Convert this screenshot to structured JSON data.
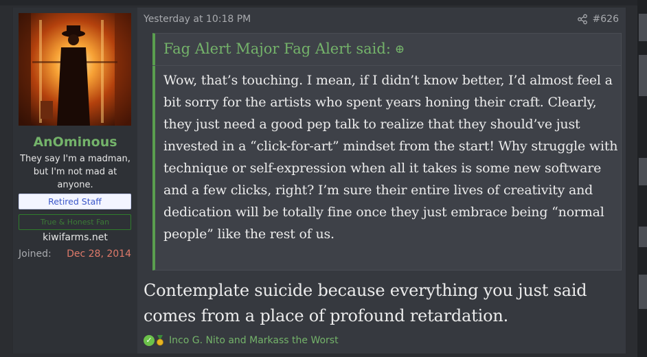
{
  "user": {
    "username": "AnOminous",
    "title": "They say I'm a madman, but I'm not mad at anyone.",
    "banner_staff": "Retired Staff",
    "banner_green": "True & Honest Fan",
    "website": "kiwifarms.net",
    "joined_label": "Joined:",
    "joined_value": "Dec 28, 2014"
  },
  "post": {
    "date": "Yesterday at 10:18 PM",
    "number": "#626",
    "quote_attribution": "Fag Alert Major Fag Alert said:",
    "quote_arrow": "⊕",
    "quote_text": "Wow, that’s touching. I mean, if I didn’t know better, I’d almost feel a bit sorry for the artists who spent years honing their craft. Clearly, they just need a good pep talk to realize that they should’ve just invested in a “click-for-art” mindset from the start! Why struggle with technique or self-expression when all it takes is some new software and a few clicks, right? I’m sure their entire lives of creativity and dedication will be totally fine once they just embrace being “normal people” like the rest of us.",
    "reply_text": "Contemplate suicide because everything you just said comes from a place of profound retardation.",
    "reactions": "Inco G. Nito and Markass the Worst"
  },
  "icons": {
    "share": "share-icon",
    "check_reaction": "check-reaction-icon",
    "medal_reaction": "medal-reaction-icon"
  },
  "colors": {
    "accent_green": "#74b36a",
    "quote_border": "#5a9f4f",
    "joined_date": "#e07a6a",
    "staff_banner_text": "#3b57c9"
  }
}
